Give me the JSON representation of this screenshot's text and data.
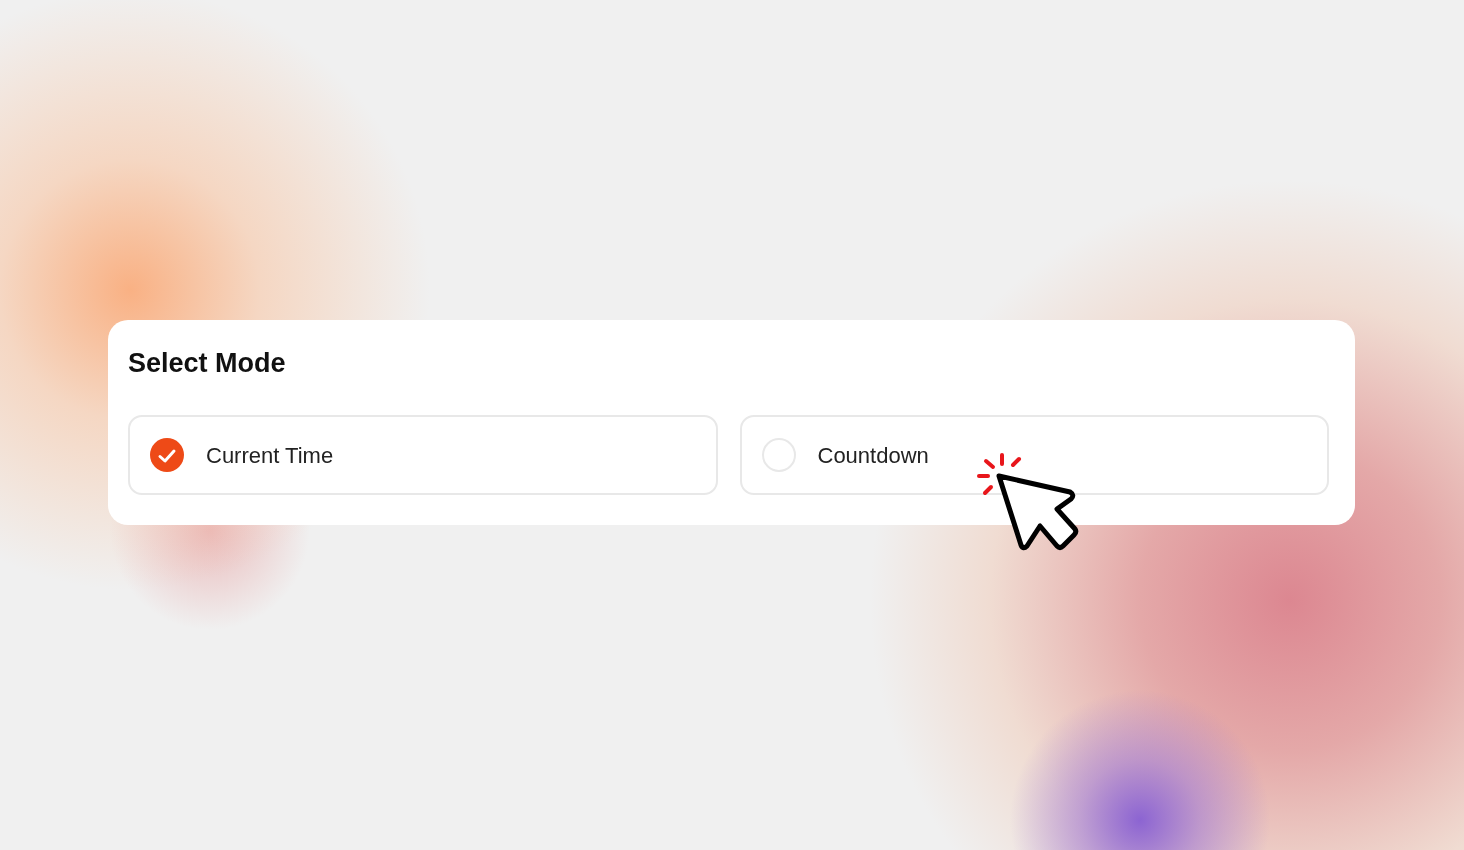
{
  "card": {
    "title": "Select Mode",
    "options": [
      {
        "label": "Current Time",
        "selected": true
      },
      {
        "label": "Countdown",
        "selected": false
      }
    ]
  }
}
